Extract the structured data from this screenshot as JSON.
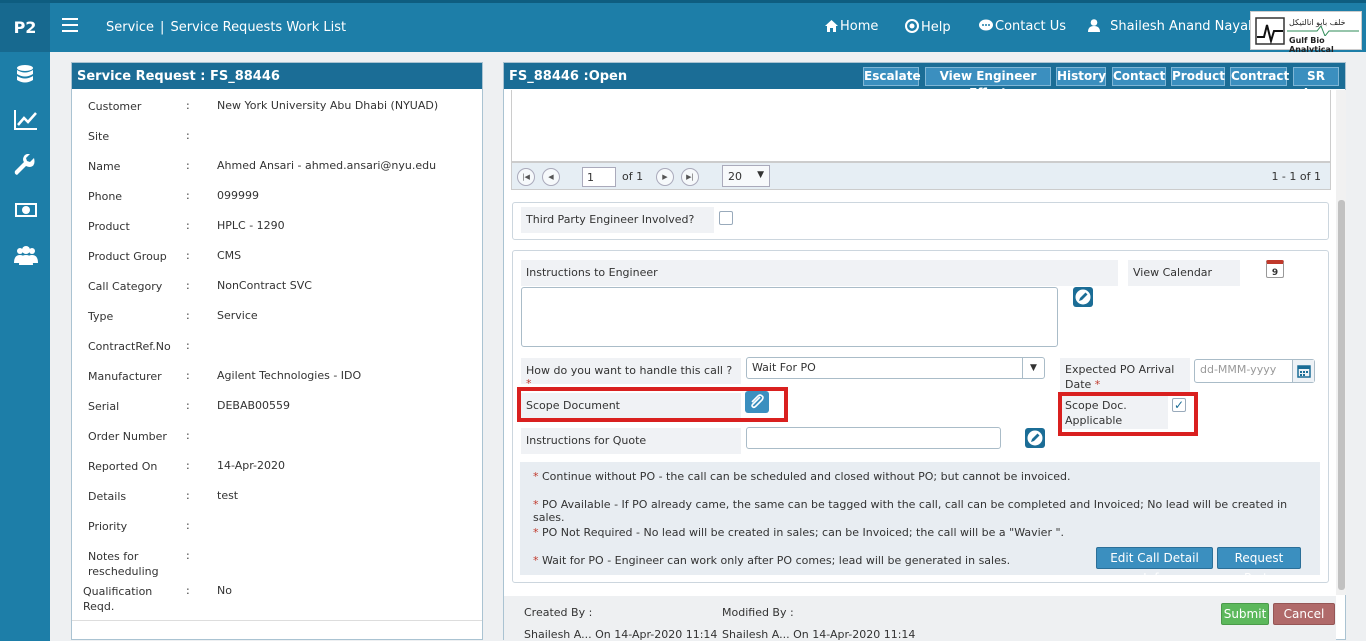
{
  "app": {
    "brand": "P2"
  },
  "breadcrumb": {
    "section": "Service",
    "separator": "|",
    "page": "Service Requests Work List"
  },
  "nav": {
    "home": "Home",
    "help": "Help",
    "contact": "Contact Us",
    "user": "Shailesh Anand Nayak"
  },
  "logo": {
    "arabic": "خلف بايو انالتيكل",
    "english": "Gulf Bio Analytical"
  },
  "sidebar": {
    "icons": [
      "database-icon",
      "chart-line-icon",
      "wrench-icon",
      "money-icon",
      "users-icon"
    ]
  },
  "left_panel": {
    "title": "Service Request : FS_88446",
    "fields": [
      {
        "label": "Customer",
        "value": "New York University Abu Dhabi (NYUAD)"
      },
      {
        "label": "Site",
        "value": ""
      },
      {
        "label": "Name",
        "value": "Ahmed Ansari - ahmed.ansari@nyu.edu"
      },
      {
        "label": "Phone",
        "value": "099999"
      },
      {
        "label": "Product",
        "value": "HPLC - 1290"
      },
      {
        "label": "Product Group",
        "value": "CMS"
      },
      {
        "label": "Call Category",
        "value": "NonContract SVC"
      },
      {
        "label": "Type",
        "value": "Service"
      },
      {
        "label": "ContractRef.No",
        "value": ""
      },
      {
        "label": "Manufacturer",
        "value": "Agilent Technologies - IDO"
      },
      {
        "label": "Serial",
        "value": "DEBAB00559"
      },
      {
        "label": "Order Number",
        "value": ""
      },
      {
        "label": "Reported On",
        "value": "14-Apr-2020"
      },
      {
        "label": "Details",
        "value": "test"
      },
      {
        "label": "Priority",
        "value": ""
      },
      {
        "label": "Notes for rescheduling",
        "value": ""
      },
      {
        "label": "Qualification Reqd.",
        "value": "No"
      }
    ],
    "colon": ":"
  },
  "right_panel": {
    "title": "FS_88446 :Open",
    "toolbar": [
      "Escalate",
      "View Engineer Effort",
      "History",
      "Contact",
      "Product",
      "Contract",
      "SR Log"
    ],
    "pager": {
      "page": "1",
      "of_label": "of 1",
      "page_size": "20",
      "range": "1 - 1 of 1"
    },
    "third_party_label": "Third Party Engineer Involved?",
    "instructions_label": "Instructions to Engineer",
    "view_calendar_label": "View Calendar",
    "calendar_day": "9",
    "handle_label": "How do you want to handle this call ?",
    "handle_value": "Wait For PO",
    "po_date_label": "Expected PO Arrival Date",
    "po_date_placeholder": "dd-MMM-yyyy",
    "scope_doc_label": "Scope Document",
    "scope_applicable_label": "Scope Doc. Applicable",
    "quote_label": "Instructions for Quote",
    "notes": [
      "Continue without PO - the call can be scheduled and closed without PO; but cannot be invoiced.",
      "PO Available - If PO already came, the same can be tagged with the call, call can be completed and Invoiced; No lead will be created in sales.",
      "PO Not Required - No lead will be created in sales; can be Invoiced; the call will be a \"Wavier \".",
      "Wait for PO - Engineer can work only after PO comes; lead will be generated in sales."
    ],
    "edit_button": "Edit Call Detail Info",
    "request_parts_button": "Request Parts",
    "created_by_label": "Created By :",
    "modified_by_label": "Modified By :",
    "created_by_value": "Shailesh A... On 14-Apr-2020 11:14",
    "modified_by_value": "Shailesh A... On 14-Apr-2020 11:14",
    "submit_button": "Submit",
    "cancel_button": "Cancel"
  },
  "colors": {
    "header": "#1d7ea8",
    "panel_head": "#1b6d96",
    "button": "#3b8fbf",
    "submit": "#5cb85c",
    "cancel": "#b06a6a",
    "highlight": "#d9201f"
  }
}
